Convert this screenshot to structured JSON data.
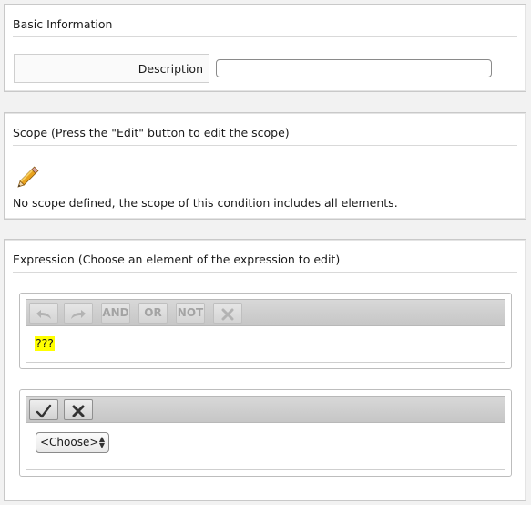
{
  "basic": {
    "title": "Basic Information",
    "description_label": "Description",
    "description_value": ""
  },
  "scope": {
    "title": "Scope (Press the \"Edit\" button to edit the scope)",
    "edit_icon": "pencil-icon",
    "empty_text": "No scope defined, the scope of this condition includes all elements."
  },
  "expression": {
    "title": "Expression (Choose an element of the expression to edit)",
    "toolbar": {
      "undo_icon": "undo-icon",
      "redo_icon": "redo-icon",
      "and_label": "AND",
      "or_label": "OR",
      "not_label": "NOT",
      "delete_icon": "delete-x-icon"
    },
    "expression_text": "???",
    "editor": {
      "confirm_icon": "checkmark-icon",
      "cancel_icon": "cancel-x-icon",
      "select_value": "<Choose>"
    }
  },
  "colors": {
    "highlight": "#ffff00",
    "panel_bg": "#ffffff",
    "page_bg": "#f2f2f2"
  }
}
